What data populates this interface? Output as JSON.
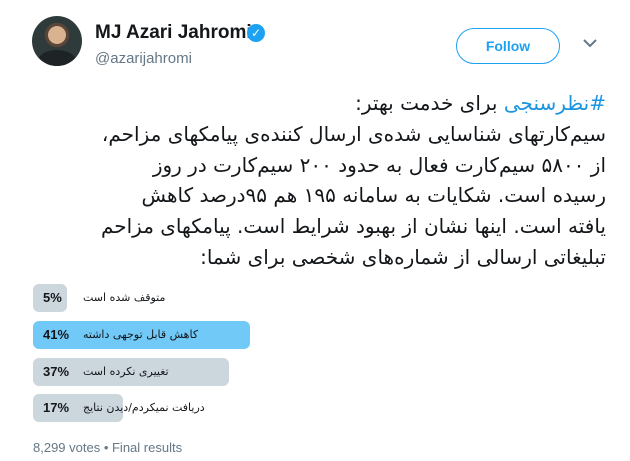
{
  "author": {
    "name": "MJ Azari Jahromi",
    "handle": "@azarijahromi",
    "verified_mark": "✓"
  },
  "follow_label": "Follow",
  "more_icon": "chevron-down-icon",
  "tweet": {
    "hashtag": "#نظرسنجی",
    "line1_rest": " برای خدمت بهتر:",
    "lines": [
      "سیم‌کارتهای شناسایی شده‌ی ارسال کننده‌ی پیامکهای مزاحم،",
      "از ۵۸۰۰ سیم‌کارت فعال به حدود ۲۰۰ سیم‌کارت در روز",
      "رسیده است. شکایات به سامانه ۱۹۵ هم ۹۵درصد کاهش",
      "یافته است. اینها نشان از بهبود شرایط است. پیامکهای مزاحم",
      "تبلیغاتی ارسالی از شماره‌های شخصی برای شما:"
    ]
  },
  "poll": {
    "options": [
      {
        "percent_label": "5%",
        "percent": 5,
        "label": "متوقف شده است",
        "leading": false
      },
      {
        "percent_label": "41%",
        "percent": 41,
        "label": "کاهش قابل توجهی داشته",
        "leading": true
      },
      {
        "percent_label": "37%",
        "percent": 37,
        "label": "تغییری نکرده است",
        "leading": false
      },
      {
        "percent_label": "17%",
        "percent": 17,
        "label": "دریافت نمیکردم/دیدن نتایج",
        "leading": false
      }
    ],
    "footer": "8,299 votes • Final results"
  },
  "colors": {
    "accent": "#1da1f2",
    "hashtag": "#1b95e0",
    "leading_bar": "#71c9f8",
    "bar": "#ccd6dd"
  }
}
